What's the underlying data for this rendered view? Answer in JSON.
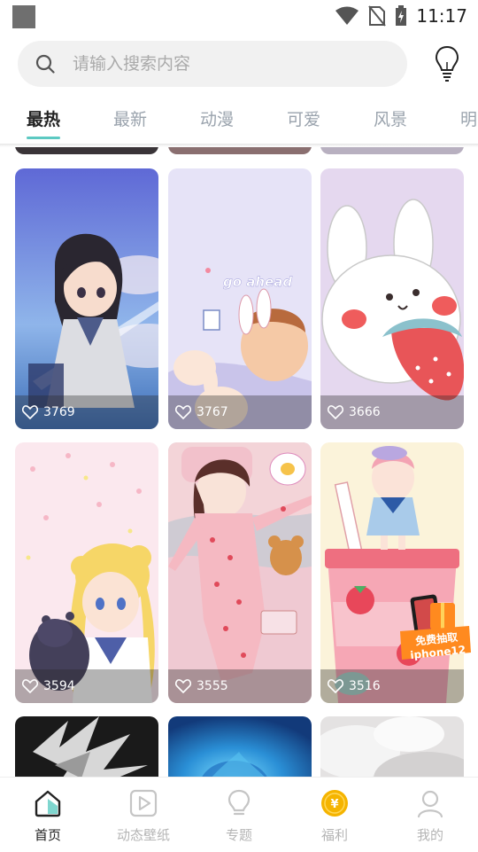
{
  "status": {
    "time": "11:17"
  },
  "search": {
    "placeholder": "请输入搜索内容"
  },
  "tabs": [
    {
      "label": "最热",
      "active": true
    },
    {
      "label": "最新"
    },
    {
      "label": "动漫"
    },
    {
      "label": "可爱"
    },
    {
      "label": "风景"
    },
    {
      "label": "明"
    }
  ],
  "grid": {
    "cards": [
      {
        "likes": "3769",
        "theme": "anime girl in school uniform under blue sky"
      },
      {
        "likes": "3767",
        "theme": "go ahead bunny cartoon"
      },
      {
        "likes": "3666",
        "theme": "white bunny with strawberry"
      },
      {
        "likes": "3594",
        "theme": "sailor moon with black cat"
      },
      {
        "likes": "3555",
        "theme": "girl in strawberry pajamas with teddy bear"
      },
      {
        "likes": "3516",
        "theme": "strawberry milk drink with girl"
      }
    ],
    "promo_badge": {
      "line1": "免费抽取",
      "line2": "iphone12"
    }
  },
  "nav": [
    {
      "label": "首页",
      "icon": "home-icon",
      "active": true
    },
    {
      "label": "动态壁纸",
      "icon": "play-icon"
    },
    {
      "label": "专题",
      "icon": "bulb-icon"
    },
    {
      "label": "福利",
      "icon": "coin-icon"
    },
    {
      "label": "我的",
      "icon": "profile-icon"
    }
  ],
  "colors": {
    "accent": "#5cc9c2",
    "coin": "#f5b400"
  }
}
